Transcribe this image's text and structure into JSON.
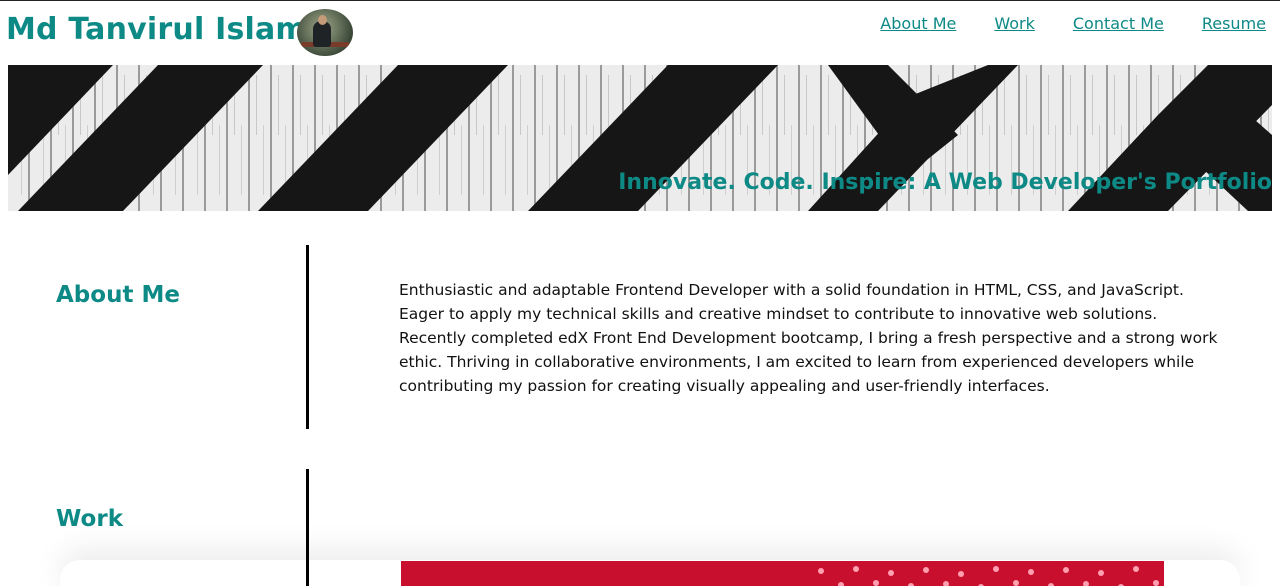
{
  "header": {
    "site_title": "Md Tanvirul Islam",
    "nav": [
      {
        "label": "About Me"
      },
      {
        "label": "Work"
      },
      {
        "label": "Contact Me"
      },
      {
        "label": "Resume"
      }
    ]
  },
  "hero": {
    "tagline": "Innovate. Code. Inspire: A Web Developer's Portfolio"
  },
  "about": {
    "heading": "About Me",
    "body": "Enthusiastic and adaptable Frontend Developer with a solid foundation in HTML, CSS, and JavaScript. Eager to apply my technical skills and creative mindset to contribute to innovative web solutions. Recently completed edX Front End Development bootcamp, I bring a fresh perspective and a strong work ethic. Thriving in collaborative environments, I am excited to learn from experienced developers while contributing my passion for creating visually appealing and user-friendly interfaces."
  },
  "work": {
    "heading": "Work"
  },
  "colors": {
    "accent": "#0e8a86",
    "text": "#111111",
    "divider": "#000000"
  }
}
